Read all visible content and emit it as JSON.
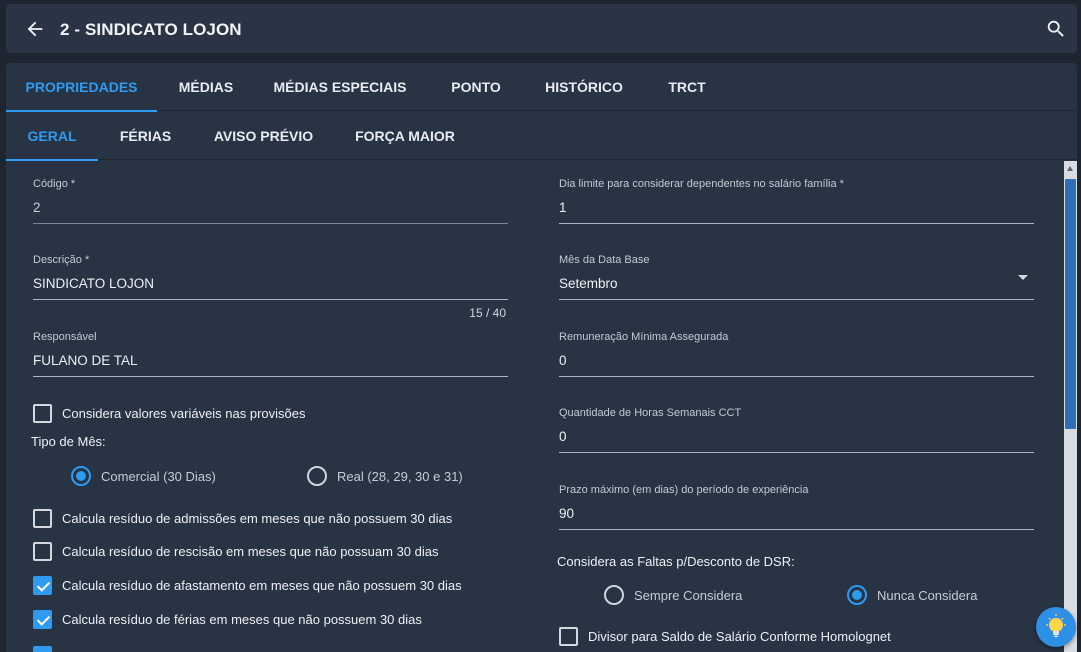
{
  "header": {
    "title": "2 - SINDICATO LOJON",
    "back_icon": "arrow-left-icon",
    "search_icon": "search-icon"
  },
  "tabs": [
    "PROPRIEDADES",
    "MÉDIAS",
    "MÉDIAS ESPECIAIS",
    "PONTO",
    "HISTÓRICO",
    "TRCT"
  ],
  "active_tab": "PROPRIEDADES",
  "subtabs": [
    "GERAL",
    "FÉRIAS",
    "AVISO PRÉVIO",
    "FORÇA MAIOR"
  ],
  "active_subtab": "GERAL",
  "left": {
    "codigo": {
      "label": "Código *",
      "value": "2"
    },
    "descricao": {
      "label": "Descrição *",
      "value": "SINDICATO LOJON",
      "counter": "15 / 40"
    },
    "responsavel": {
      "label": "Responsável",
      "value": "FULANO DE TAL"
    },
    "considera_variaveis": {
      "label": "Considera valores variáveis nas provisões",
      "checked": false
    },
    "tipo_mes": {
      "label": "Tipo de Mês:",
      "options": [
        "Comercial (30 Dias)",
        "Real (28, 29, 30 e 31)"
      ],
      "selected": "Comercial (30 Dias)"
    },
    "checks": [
      {
        "label": "Calcula resíduo de admissões em meses que não possuem 30 dias",
        "checked": false
      },
      {
        "label": "Calcula resíduo de rescisão em meses que não possuam 30 dias",
        "checked": false
      },
      {
        "label": "Calcula resíduo de afastamento em meses que não possuem 30 dias",
        "checked": true
      },
      {
        "label": "Calcula resíduo de férias em meses que não possuem 30 dias",
        "checked": true
      }
    ]
  },
  "right": {
    "dia_limite": {
      "label": "Dia limite para considerar dependentes no salário família *",
      "value": "1"
    },
    "mes_data_base": {
      "label": "Mês da Data Base",
      "value": "Setembro"
    },
    "remuneracao": {
      "label": "Remuneração Mínima Assegurada",
      "value": "0"
    },
    "horas_semanais": {
      "label": "Quantidade de Horas Semanais CCT",
      "value": "0"
    },
    "prazo_experiencia": {
      "label": "Prazo máximo (em dias) do período de experiência",
      "value": "90"
    },
    "faltas_dsr": {
      "label": "Considera as Faltas p/Desconto de DSR:",
      "options": [
        "Sempre Considera",
        "Nunca Considera"
      ],
      "selected": "Nunca Considera"
    },
    "divisor": {
      "label": "Divisor para Saldo de Salário Conforme Homolognet",
      "checked": false
    }
  },
  "colors": {
    "accent": "#2e9bf0",
    "background": "#1e2530",
    "panel": "#283344"
  },
  "fab_icon": "lightbulb-icon"
}
